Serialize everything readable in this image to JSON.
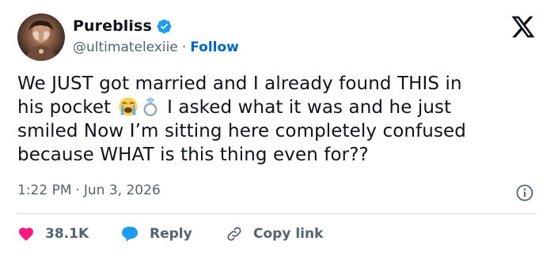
{
  "user": {
    "display_name": "Purebliss",
    "handle": "@ultimatelexiie",
    "separator": "·",
    "follow_label": "Follow",
    "avatar_icon": "profile-photo",
    "verified_color": "#1d9bf0"
  },
  "tweet": {
    "lines": [
      "We JUST got married and I already found THIS in",
      "his pocket",
      "I asked what it was and he just",
      "smiled Now I’m sitting here completely confused",
      "because WHAT is this thing even for??"
    ],
    "emojis": [
      "loudly-crying-face-emoji",
      "ring-emoji"
    ]
  },
  "meta": {
    "time": "1:22 PM",
    "separator": "·",
    "date": "Jun 3, 2026"
  },
  "actions": {
    "like_count": "38.1K",
    "reply_label": "Reply",
    "copy_label": "Copy link"
  },
  "colors": {
    "like": "#f91880",
    "reply": "#1d9bf0",
    "link": "#0066cc",
    "muted": "#536471"
  }
}
